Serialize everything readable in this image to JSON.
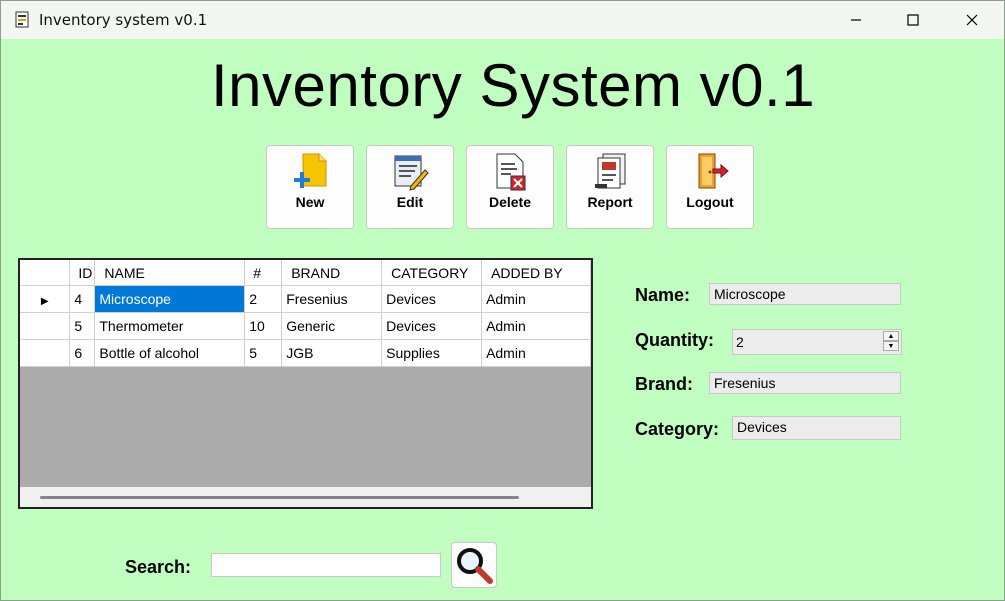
{
  "window": {
    "title": "Inventory system v0.1"
  },
  "app_title": "Inventory System v0.1",
  "toolbar": {
    "new_label": "New",
    "edit_label": "Edit",
    "delete_label": "Delete",
    "report_label": "Report",
    "logout_label": "Logout"
  },
  "grid": {
    "columns": [
      "ID",
      "NAME",
      "#",
      "BRAND",
      "CATEGORY",
      "ADDED BY"
    ],
    "rows": [
      {
        "id": "4",
        "name": "Microscope",
        "qty": "2",
        "brand": "Fresenius",
        "category": "Devices",
        "added_by": "Admin"
      },
      {
        "id": "5",
        "name": "Thermometer",
        "qty": "10",
        "brand": "Generic",
        "category": "Devices",
        "added_by": "Admin"
      },
      {
        "id": "6",
        "name": "Bottle of alcohol",
        "qty": "5",
        "brand": "JGB",
        "category": "Supplies",
        "added_by": "Admin"
      }
    ],
    "selected_row": 0
  },
  "form": {
    "name_label": "Name:",
    "name_value": "Microscope",
    "quantity_label": "Quantity:",
    "quantity_value": "2",
    "brand_label": "Brand:",
    "brand_value": "Fresenius",
    "category_label": "Category:",
    "category_value": "Devices"
  },
  "search": {
    "label": "Search:",
    "value": ""
  },
  "colors": {
    "background": "#c0ffc0",
    "selection": "#0078d7"
  }
}
